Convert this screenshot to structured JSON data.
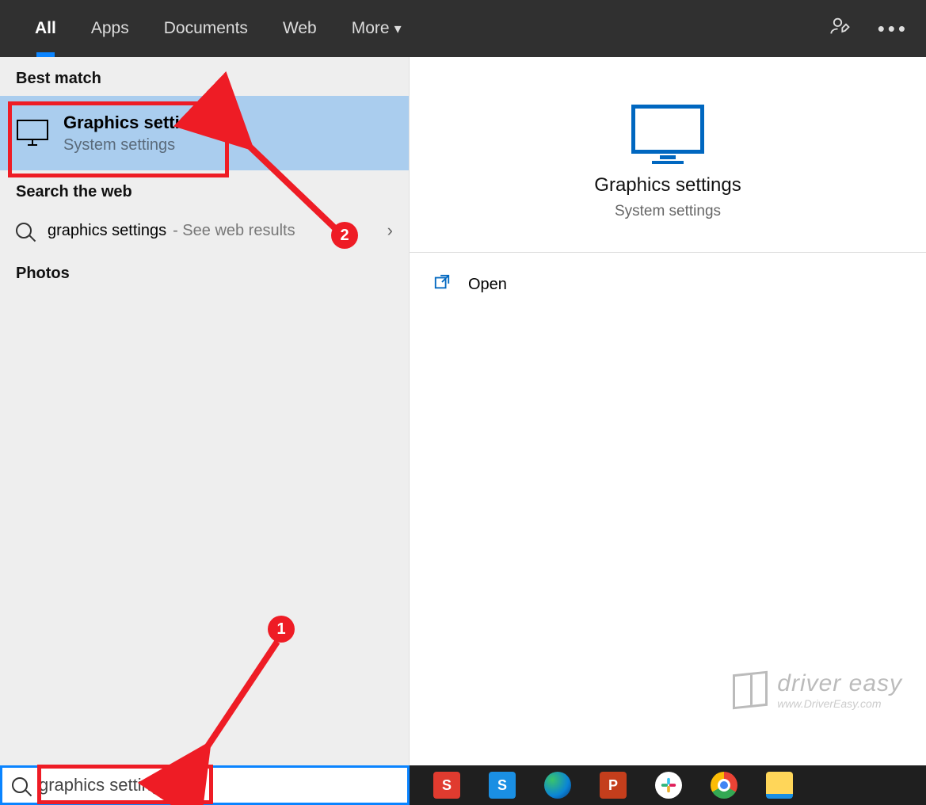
{
  "tabs": {
    "all": "All",
    "apps": "Apps",
    "documents": "Documents",
    "web": "Web",
    "more": "More"
  },
  "sections": {
    "best_match": "Best match",
    "search_web": "Search the web",
    "photos": "Photos"
  },
  "best_match": {
    "title": "Graphics settings",
    "subtitle": "System settings"
  },
  "web_result": {
    "query": "graphics settings",
    "suffix": "- See web results"
  },
  "preview": {
    "title": "Graphics settings",
    "subtitle": "System settings",
    "open": "Open"
  },
  "search": {
    "value": "graphics settings"
  },
  "annotations": {
    "badge1": "1",
    "badge2": "2"
  },
  "watermark": {
    "brand": "driver easy",
    "url": "www.DriverEasy.com"
  }
}
